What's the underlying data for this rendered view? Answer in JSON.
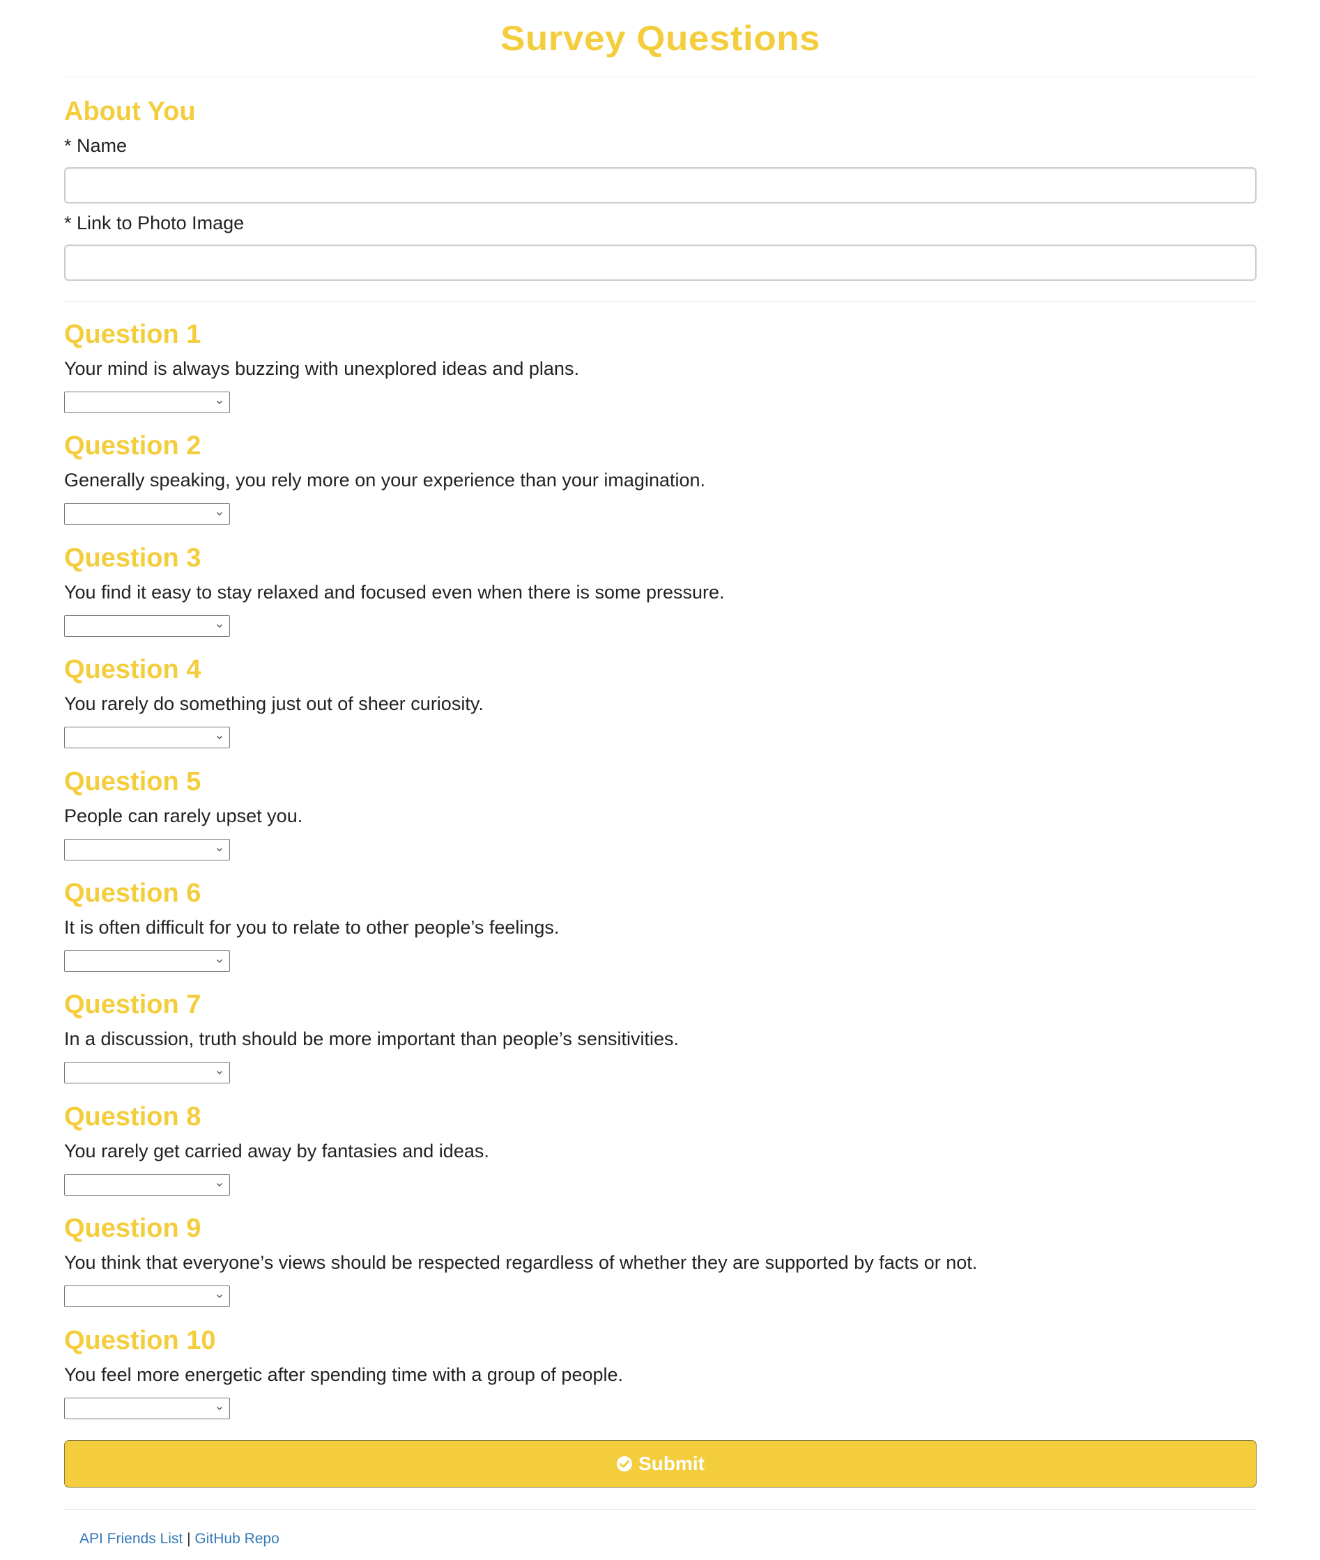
{
  "header": {
    "title": "Survey Questions"
  },
  "about": {
    "heading": "About You",
    "name_label": "* Name",
    "name_value": "",
    "photo_label": "* Link to Photo Image",
    "photo_value": ""
  },
  "questions": [
    {
      "heading": "Question 1",
      "text": "Your mind is always buzzing with unexplored ideas and plans.",
      "selected": ""
    },
    {
      "heading": "Question 2",
      "text": "Generally speaking, you rely more on your experience than your imagination.",
      "selected": ""
    },
    {
      "heading": "Question 3",
      "text": "You find it easy to stay relaxed and focused even when there is some pressure.",
      "selected": ""
    },
    {
      "heading": "Question 4",
      "text": "You rarely do something just out of sheer curiosity.",
      "selected": ""
    },
    {
      "heading": "Question 5",
      "text": "People can rarely upset you.",
      "selected": ""
    },
    {
      "heading": "Question 6",
      "text": "It is often difficult for you to relate to other people’s feelings.",
      "selected": ""
    },
    {
      "heading": "Question 7",
      "text": "In a discussion, truth should be more important than people’s sensitivities.",
      "selected": ""
    },
    {
      "heading": "Question 8",
      "text": "You rarely get carried away by fantasies and ideas.",
      "selected": ""
    },
    {
      "heading": "Question 9",
      "text": "You think that everyone’s views should be respected regardless of whether they are supported by facts or not.",
      "selected": ""
    },
    {
      "heading": "Question 10",
      "text": "You feel more energetic after spending time with a group of people.",
      "selected": ""
    }
  ],
  "submit": {
    "label": "Submit",
    "icon": "check-circle-icon"
  },
  "footer": {
    "link1": "API Friends List",
    "separator": "|",
    "link2": "GitHub Repo"
  },
  "colors": {
    "accent": "#f4cd3d",
    "link": "#337ab7",
    "text": "#222222"
  }
}
